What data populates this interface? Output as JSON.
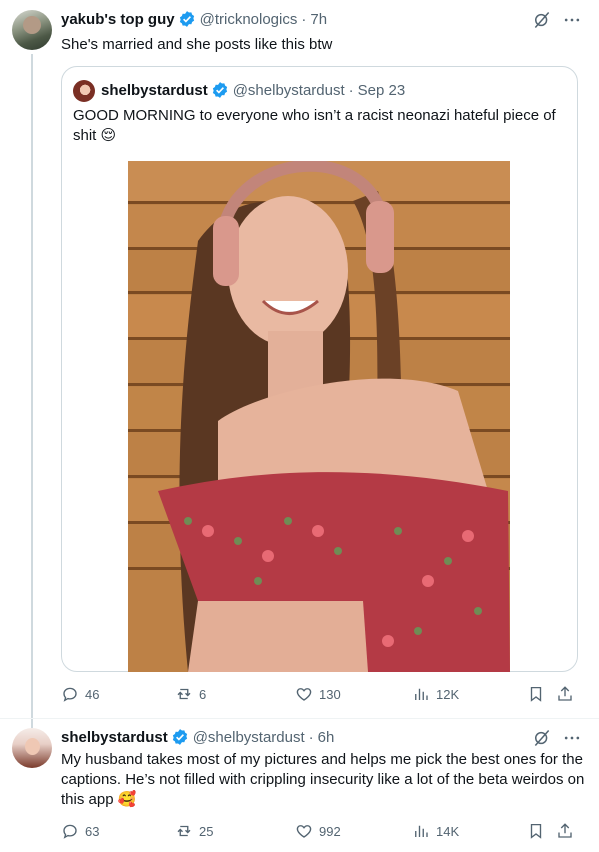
{
  "tweet1": {
    "author_name": "yakub's top guy",
    "handle": "@tricknologics",
    "separator": "·",
    "time": "7h",
    "text": "She's married and she posts like this btw",
    "quote": {
      "author_name": "shelbystardust",
      "handle": "@shelbystardust",
      "separator": "·",
      "date": "Sep 23",
      "text": "GOOD MORNING to everyone who isn’t a racist neonazi hateful piece of shit 😌"
    },
    "stats": {
      "replies": "46",
      "reposts": "6",
      "likes": "130",
      "views": "12K"
    }
  },
  "tweet2": {
    "author_name": "shelbystardust",
    "handle": "@shelbystardust",
    "separator": "·",
    "time": "6h",
    "text": "My husband takes most of my pictures and helps me pick the best ones for the captions. He’s not filled with crippling insecurity like a lot of the beta weirdos on this app 🥰",
    "stats": {
      "replies": "63",
      "reposts": "25",
      "likes": "992",
      "views": "14K"
    }
  },
  "icons": {
    "verified": "verified-badge-icon",
    "grok": "grok-slash-icon",
    "more": "more-dots-icon",
    "reply": "reply-icon",
    "repost": "repost-icon",
    "like": "heart-icon",
    "views": "views-icon",
    "bookmark": "bookmark-icon",
    "share": "share-icon"
  },
  "colors": {
    "verified": "#1d9bf0",
    "muted": "#536471",
    "text": "#0f1419",
    "border": "#cfd9de"
  }
}
